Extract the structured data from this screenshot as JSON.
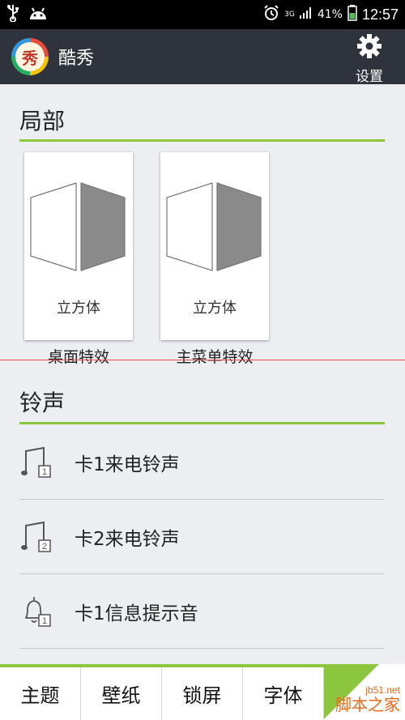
{
  "status_bar": {
    "network": "3G",
    "battery": "41%",
    "time": "12:57"
  },
  "app_bar": {
    "logo_char": "秀",
    "title": "酷秀",
    "settings_label": "设置"
  },
  "local_section": {
    "title": "局部",
    "cards": [
      {
        "caption": "立方体",
        "label": "桌面特效"
      },
      {
        "caption": "立方体",
        "label": "主菜单特效"
      }
    ]
  },
  "ringtone_section": {
    "title": "铃声",
    "items": [
      {
        "label": "卡1来电铃声",
        "icon": "music-note-sim1-icon",
        "badge": "1"
      },
      {
        "label": "卡2来电铃声",
        "icon": "music-note-sim2-icon",
        "badge": "2"
      },
      {
        "label": "卡1信息提示音",
        "icon": "bell-sim1-icon",
        "badge": "1"
      }
    ]
  },
  "tabs": [
    "主题",
    "壁纸",
    "锁屏",
    "字体"
  ],
  "watermark": {
    "site": "jb51.net",
    "name": "脚本之家"
  },
  "colors": {
    "accent": "#8cc63f",
    "app_bar": "#2f343c",
    "background": "#eceef2"
  }
}
